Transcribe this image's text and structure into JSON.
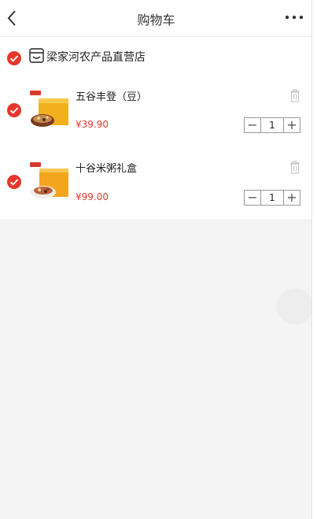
{
  "header": {
    "title": "购物车"
  },
  "shop": {
    "name": "梁家河农产品直营店"
  },
  "items": [
    {
      "name": "五谷丰登（豆）",
      "price": "¥39.90",
      "qty": "1"
    },
    {
      "name": "十谷米粥礼盒",
      "price": "¥99.00",
      "qty": "1"
    }
  ],
  "colors": {
    "accent": "#e5372d",
    "background": "#f4f4f5"
  }
}
